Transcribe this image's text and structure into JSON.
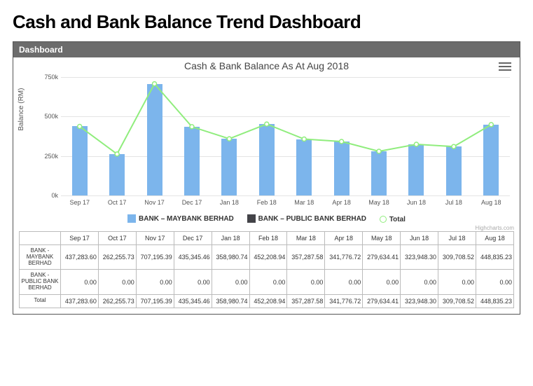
{
  "page": {
    "title": "Cash and Bank Balance Trend Dashboard"
  },
  "panel": {
    "header": "Dashboard",
    "credit": "Highcharts.com"
  },
  "chart_data": {
    "type": "bar",
    "title": "Cash & Bank Balance As At Aug 2018",
    "ylabel": "Balance (RM)",
    "ylim": [
      0,
      750000
    ],
    "yticks": [
      {
        "v": 0,
        "label": "0k"
      },
      {
        "v": 250000,
        "label": "250k"
      },
      {
        "v": 500000,
        "label": "500k"
      },
      {
        "v": 750000,
        "label": "750k"
      }
    ],
    "categories": [
      "Sep 17",
      "Oct 17",
      "Nov 17",
      "Dec 17",
      "Jan 18",
      "Feb 18",
      "Mar 18",
      "Apr 18",
      "May 18",
      "Jun 18",
      "Jul 18",
      "Aug 18"
    ],
    "series": [
      {
        "name": "BANK – MAYBANK BERHAD",
        "type": "bar",
        "color": "#7cb5ec",
        "values": [
          437283.6,
          262255.73,
          707195.39,
          435345.46,
          358980.74,
          452208.94,
          357287.58,
          341776.72,
          279634.41,
          323948.3,
          309708.52,
          448835.23
        ]
      },
      {
        "name": "BANK – PUBLIC BANK BERHAD",
        "type": "bar",
        "color": "#434348",
        "values": [
          0.0,
          0.0,
          0.0,
          0.0,
          0.0,
          0.0,
          0.0,
          0.0,
          0.0,
          0.0,
          0.0,
          0.0
        ]
      },
      {
        "name": "Total",
        "type": "line",
        "color": "#90ed7d",
        "values": [
          437283.6,
          262255.73,
          707195.39,
          435345.46,
          358980.74,
          452208.94,
          357287.58,
          341776.72,
          279634.41,
          323948.3,
          309708.52,
          448835.23
        ]
      }
    ]
  },
  "table": {
    "row_headers": [
      "",
      "BANK - MAYBANK BERHAD",
      "BANK - PUBLIC BANK BERHAD",
      "Total"
    ],
    "columns": [
      "Sep 17",
      "Oct 17",
      "Nov 17",
      "Dec 17",
      "Jan 18",
      "Feb 18",
      "Mar 18",
      "Apr 18",
      "May 18",
      "Jun 18",
      "Jul 18",
      "Aug 18"
    ],
    "rows": [
      [
        "437,283.60",
        "262,255.73",
        "707,195.39",
        "435,345.46",
        "358,980.74",
        "452,208.94",
        "357,287.58",
        "341,776.72",
        "279,634.41",
        "323,948.30",
        "309,708.52",
        "448,835.23"
      ],
      [
        "0.00",
        "0.00",
        "0.00",
        "0.00",
        "0.00",
        "0.00",
        "0.00",
        "0.00",
        "0.00",
        "0.00",
        "0.00",
        "0.00"
      ],
      [
        "437,283.60",
        "262,255.73",
        "707,195.39",
        "435,345.46",
        "358,980.74",
        "452,208.94",
        "357,287.58",
        "341,776.72",
        "279,634.41",
        "323,948.30",
        "309,708.52",
        "448,835.23"
      ]
    ]
  }
}
